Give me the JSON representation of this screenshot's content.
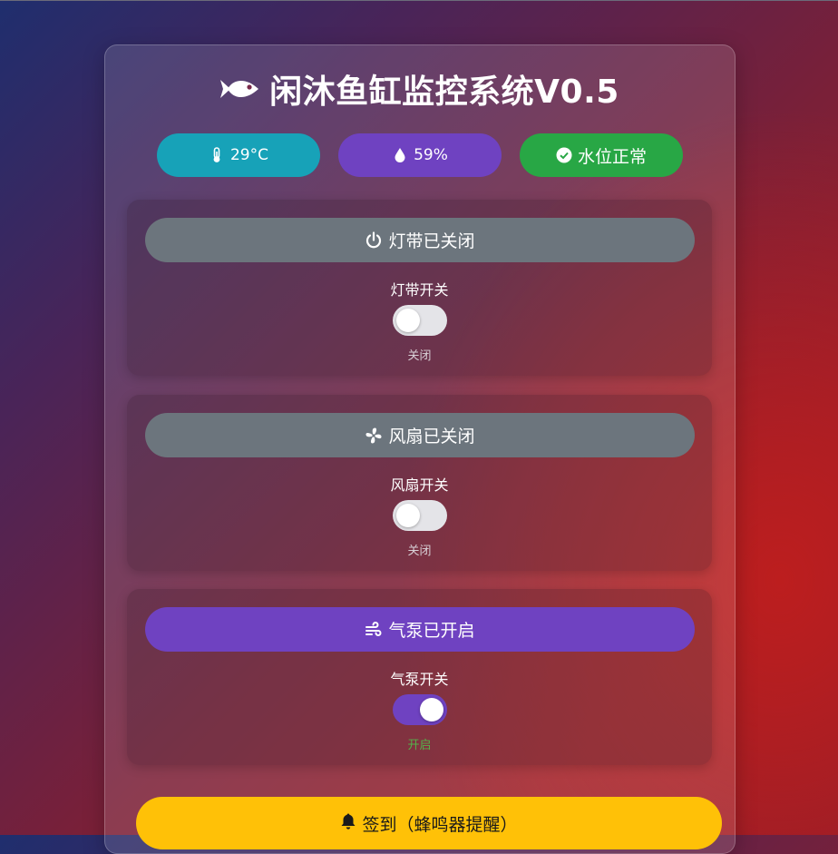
{
  "app": {
    "title": "闲沐鱼缸监控系统V0.5",
    "title_icon": "fish-icon"
  },
  "status": {
    "temperature": {
      "icon": "thermometer-icon",
      "value": "29°C",
      "color": "#17a2b8"
    },
    "humidity": {
      "icon": "droplet-icon",
      "value": "59%",
      "color": "#6f42c1"
    },
    "water_level": {
      "icon": "check-circle-icon",
      "value": "水位正常",
      "color": "#28a745"
    }
  },
  "devices": {
    "light": {
      "button_icon": "power-icon",
      "button_label": "灯带已关闭",
      "switch_label": "灯带开关",
      "switch_on": false,
      "state_text": "关闭"
    },
    "fan": {
      "button_icon": "fan-icon",
      "button_label": "风扇已关闭",
      "switch_label": "风扇开关",
      "switch_on": false,
      "state_text": "关闭"
    },
    "pump": {
      "button_icon": "wind-icon",
      "button_label": "气泵已开启",
      "switch_label": "气泵开关",
      "switch_on": true,
      "state_text": "开启"
    }
  },
  "checkin": {
    "icon": "bell-icon",
    "label": "签到（蜂鸣器提醒）",
    "color": "#ffc107"
  },
  "colors": {
    "off_gray": "#6c757d",
    "on_purple": "#6f42c1",
    "on_green_text": "#55b24a"
  }
}
